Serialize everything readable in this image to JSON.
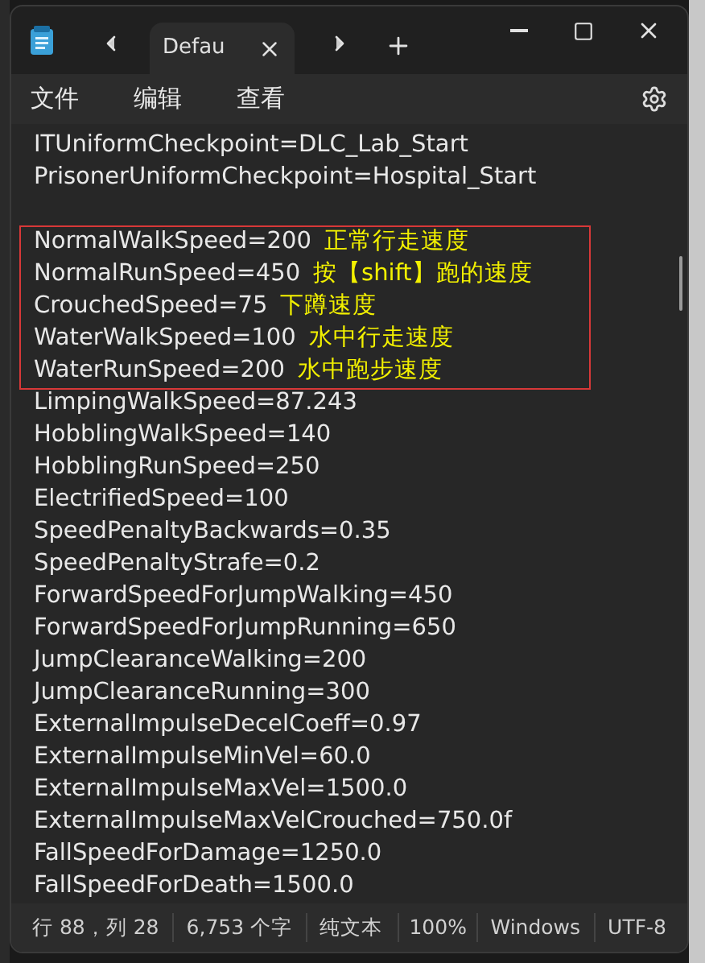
{
  "tab": {
    "title": "Defau",
    "selected": true
  },
  "menu": [
    "文件",
    "编辑",
    "查看"
  ],
  "editor": {
    "lines_before": [
      {
        "text": "ITUniformCheckpoint=DLC_Lab_Start"
      },
      {
        "text": "PrisonerUniformCheckpoint=Hospital_Start"
      }
    ],
    "annotated_block": [
      {
        "text": "NormalWalkSpeed=200",
        "note": "正常行走速度"
      },
      {
        "text": "NormalRunSpeed=450",
        "note": "按【shift】跑的速度"
      },
      {
        "text": "CrouchedSpeed=75",
        "note": "下蹲速度"
      },
      {
        "text": "WaterWalkSpeed=100",
        "note": "水中行走速度"
      },
      {
        "text": "WaterRunSpeed=200",
        "note": "水中跑步速度"
      }
    ],
    "lines_after": [
      {
        "text": "LimpingWalkSpeed=87.243"
      },
      {
        "text": "HobblingWalkSpeed=140"
      },
      {
        "text": "HobblingRunSpeed=250"
      },
      {
        "text": "ElectrifiedSpeed=100"
      },
      {
        "text": "SpeedPenaltyBackwards=0.35"
      },
      {
        "text": "SpeedPenaltyStrafe=0.2"
      },
      {
        "text": "ForwardSpeedForJumpWalking=450"
      },
      {
        "text": "ForwardSpeedForJumpRunning=650"
      },
      {
        "text": "JumpClearanceWalking=200"
      },
      {
        "text": "JumpClearanceRunning=300"
      },
      {
        "text": "ExternalImpulseDecelCoeff=0.97"
      },
      {
        "text": "ExternalImpulseMinVel=60.0"
      },
      {
        "text": "ExternalImpulseMaxVel=1500.0"
      },
      {
        "text": "ExternalImpulseMaxVelCrouched=750.0f"
      },
      {
        "text": "FallSpeedForDamage=1250.0"
      },
      {
        "text": "FallSpeedForDeath=1500.0"
      }
    ]
  },
  "status_bar": [
    "行 88，列 28",
    "6,753 个字",
    "纯文本",
    "100%",
    "Windows",
    "UTF-8"
  ]
}
